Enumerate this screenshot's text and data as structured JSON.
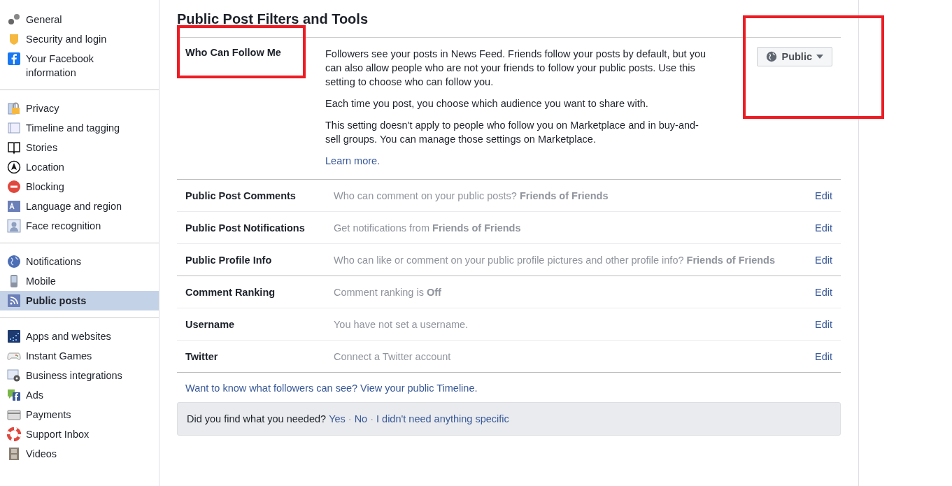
{
  "sidebar": {
    "sections": [
      {
        "items": [
          {
            "label": "General",
            "selected": false
          },
          {
            "label": "Security and login",
            "selected": false
          },
          {
            "label": "Your Facebook information",
            "selected": false
          }
        ]
      },
      {
        "items": [
          {
            "label": "Privacy",
            "selected": false
          },
          {
            "label": "Timeline and tagging",
            "selected": false
          },
          {
            "label": "Stories",
            "selected": false
          },
          {
            "label": "Location",
            "selected": false
          },
          {
            "label": "Blocking",
            "selected": false
          },
          {
            "label": "Language and region",
            "selected": false
          },
          {
            "label": "Face recognition",
            "selected": false
          }
        ]
      },
      {
        "items": [
          {
            "label": "Notifications",
            "selected": false
          },
          {
            "label": "Mobile",
            "selected": false
          },
          {
            "label": "Public posts",
            "selected": true
          }
        ]
      },
      {
        "items": [
          {
            "label": "Apps and websites",
            "selected": false
          },
          {
            "label": "Instant Games",
            "selected": false
          },
          {
            "label": "Business integrations",
            "selected": false
          },
          {
            "label": "Ads",
            "selected": false
          },
          {
            "label": "Payments",
            "selected": false
          },
          {
            "label": "Support Inbox",
            "selected": false
          },
          {
            "label": "Videos",
            "selected": false
          }
        ]
      }
    ]
  },
  "main": {
    "title": "Public Post Filters and Tools",
    "follow": {
      "label": "Who Can Follow Me",
      "label_highlighted": true,
      "paragraphs": [
        "Followers see your posts in News Feed. Friends follow your posts by default, but you can also allow people who are not your friends to follow your public posts. Use this setting to choose who can follow you.",
        "Each time you post, you choose which audience you want to share with.",
        "This setting doesn't apply to people who follow you on Marketplace and in buy-and-sell groups. You can manage those settings on Marketplace."
      ],
      "link": "Learn more.",
      "audience": "Public",
      "audience_highlighted": true
    },
    "groups": [
      [
        {
          "label": "Public Post Comments",
          "value": "Who can comment on your public posts? **Friends of Friends**",
          "action": "Edit"
        },
        {
          "label": "Public Post Notifications",
          "value": "Get notifications from **Friends of Friends**",
          "action": "Edit"
        },
        {
          "label": "Public Profile Info",
          "value": "Who can like or comment on your public profile pictures and other profile info? **Friends of Friends**",
          "action": "Edit"
        }
      ],
      [
        {
          "label": "Comment Ranking",
          "value": "Comment ranking is **Off**",
          "action": "Edit"
        },
        {
          "label": "Username",
          "value": "You have not set a username.",
          "action": "Edit"
        },
        {
          "label": "Twitter",
          "value": "Connect a Twitter account",
          "action": "Edit"
        }
      ]
    ],
    "timeline_link": "Want to know what followers can see? View your public Timeline.",
    "feedback": {
      "question": "Did you find what you needed?",
      "options": [
        "Yes",
        "No",
        "I didn't need anything specific"
      ],
      "separator": "·"
    }
  }
}
